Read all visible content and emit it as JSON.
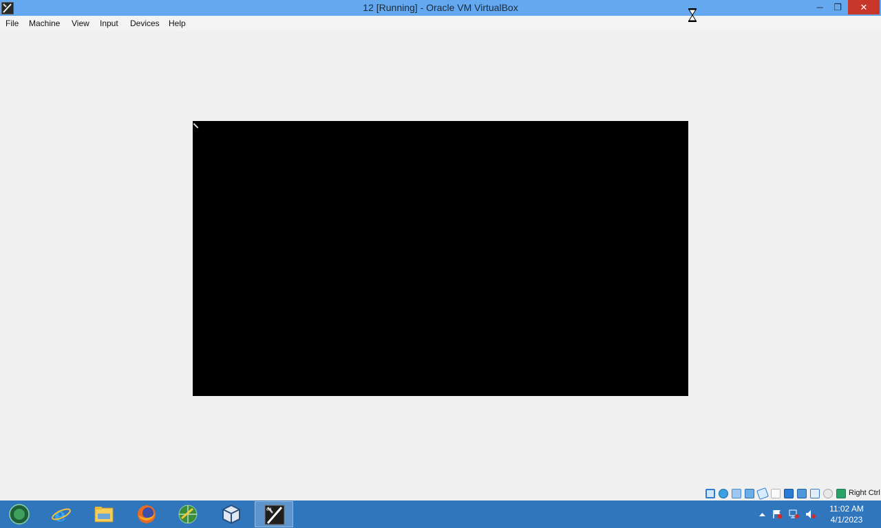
{
  "window": {
    "title": "12 [Running] - Oracle VM VirtualBox",
    "minimize_glyph": "─",
    "maximize_glyph": "❐",
    "close_glyph": "✕"
  },
  "menu": {
    "items": [
      "File",
      "Machine",
      "View",
      "Input",
      "Devices",
      "Help"
    ]
  },
  "statusbar": {
    "icons": [
      "hard-disk-icon",
      "optical-drive-icon",
      "audio-icon",
      "network-icon",
      "usb-icon",
      "shared-folders-icon",
      "display-icon",
      "recording-icon",
      "cpu-icon",
      "vt-icon",
      "mouse-integration-icon",
      "keyboard-icon"
    ],
    "host_key": "Right Ctrl"
  },
  "taskbar": {
    "apps": [
      "start-button",
      "internet-explorer-icon",
      "file-explorer-icon",
      "firefox-icon",
      "network-globe-icon",
      "virtualbox-manager-icon",
      "virtualbox-vm-icon"
    ]
  },
  "tray": {
    "time": "11:02 AM",
    "date": "4/1/2023"
  },
  "colors": {
    "titlebar": "#64a8f0",
    "taskbar": "#2f76bd",
    "vm_screen": "#000000",
    "close_button": "#c7352b"
  }
}
